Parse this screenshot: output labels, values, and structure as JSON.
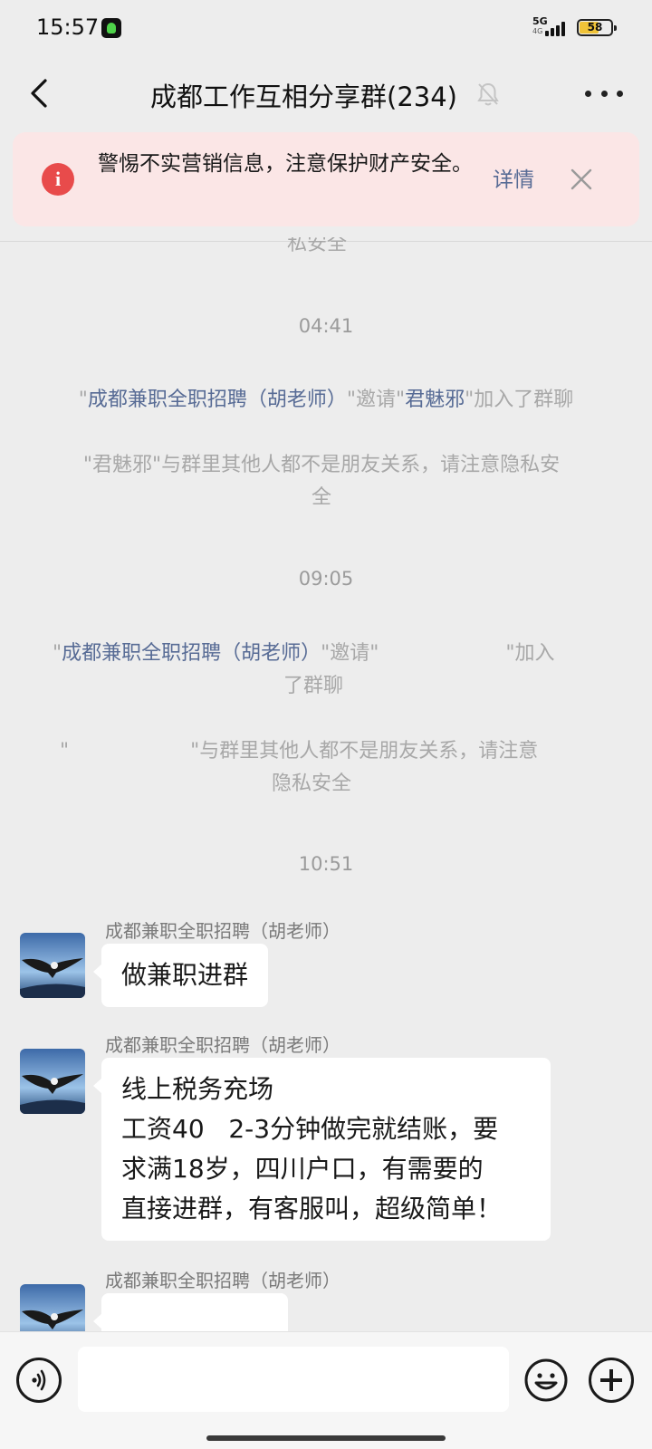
{
  "status_bar": {
    "time": "15:57",
    "network": "5G",
    "battery": "58",
    "battery_level": 0.58
  },
  "nav": {
    "title": "成都工作互相分享群(234)"
  },
  "warning": {
    "text": "警惕不实营销信息，注意保护财产安全。",
    "detail_label": "详情"
  },
  "chat": {
    "top_fragment": "私安全",
    "timestamps": [
      "04:41",
      "09:05",
      "10:51"
    ],
    "sys_invite_1": {
      "q1": "\"",
      "inviter": "成都兼职全职招聘（胡老师）",
      "q2": "\"邀请\"",
      "invitee": "君魅邪",
      "tail": "\"加入了群聊"
    },
    "sys_notice_1": {
      "line1": "\"君魅邪\"与群里其他人都不是朋友关系，请注意隐私安",
      "line2": "全"
    },
    "sys_invite_2": {
      "q1": "\"",
      "inviter": "成都兼职全职招聘（胡老师）",
      "q2": "\"邀请\"",
      "tail": "\"加入",
      "line2": "了群聊"
    },
    "sys_notice_2": {
      "q1": "\"",
      "line1": "\"与群里其他人都不是朋友关系，请注意",
      "line2": "隐私安全"
    },
    "messages": [
      {
        "sender": "成都兼职全职招聘（胡老师）",
        "lines": [
          "做兼职进群"
        ]
      },
      {
        "sender": "成都兼职全职招聘（胡老师）",
        "lines": [
          "线上税务充场",
          "工资40   2-3分钟做完就结账，要",
          "求满18岁，四川户口，有需要的",
          "直接进群，有客服叫，超级简单！"
        ]
      },
      {
        "sender": "成都兼职全职招聘（胡老师）",
        "lines": []
      }
    ]
  },
  "input": {
    "placeholder": "",
    "value": ""
  },
  "icons": {
    "back": "chevron-left-icon",
    "mute": "bell-mute-icon",
    "more": "more-dots-icon",
    "warning": "info-icon",
    "close": "close-icon",
    "voice": "voice-icon",
    "emoji": "emoji-icon",
    "plus": "plus-icon"
  },
  "colors": {
    "link": "#576b95",
    "warning_bg": "#fbe6e6",
    "warning_icon": "#e84b4b",
    "chat_bg": "#ededed"
  }
}
